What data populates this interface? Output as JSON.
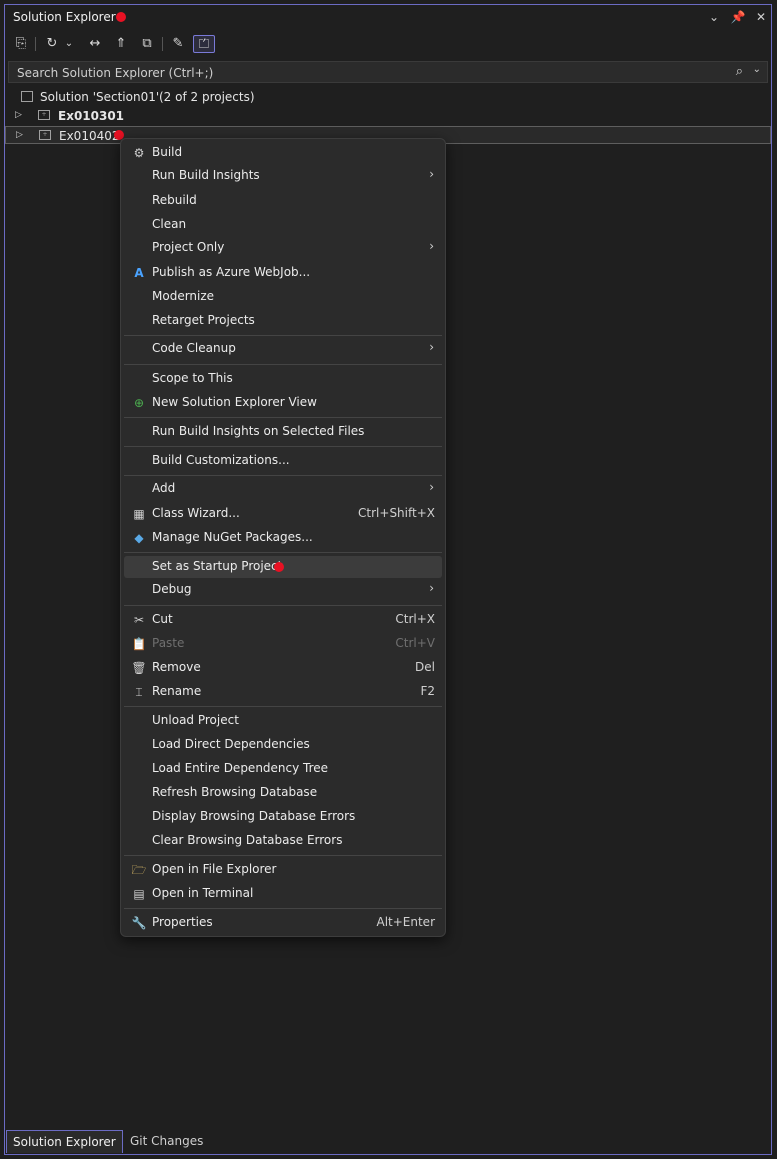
{
  "window": {
    "title": "Solution Explorer",
    "buttons": [
      "chevron-down-icon",
      "pin-icon",
      "close-icon"
    ]
  },
  "toolbar": {
    "buttons": [
      {
        "name": "switch-views-icon",
        "glyph": "⎘"
      },
      {
        "name": "history-icon",
        "glyph": "↻"
      },
      {
        "name": "history-dropdown-icon",
        "glyph": "⌄"
      },
      {
        "name": "sync-icon",
        "glyph": "↔"
      },
      {
        "name": "collapse-all-icon",
        "glyph": "⇑"
      },
      {
        "name": "show-all-files-icon",
        "glyph": "⧉"
      },
      {
        "name": "properties-wrench-icon",
        "glyph": "✎"
      },
      {
        "name": "preview-selected-icon",
        "glyph": "⏍"
      }
    ]
  },
  "search": {
    "placeholder": "Search Solution Explorer (Ctrl+;)"
  },
  "tree": {
    "solution": "Solution 'Section01'",
    "solution_count": "(2 of 2 projects)",
    "projects": [
      {
        "name": "Ex010301",
        "bold": true
      },
      {
        "name": "Ex010402",
        "bold": false,
        "selected": true
      }
    ]
  },
  "context_menu": {
    "items": {
      "build": {
        "label": "Build"
      },
      "run_build_insights": {
        "label": "Run Build Insights"
      },
      "rebuild": {
        "label": "Rebuild"
      },
      "clean": {
        "label": "Clean"
      },
      "project_only": {
        "label": "Project Only"
      },
      "publish_azure": {
        "label": "Publish as Azure WebJob..."
      },
      "modernize": {
        "label": "Modernize"
      },
      "retarget": {
        "label": "Retarget Projects"
      },
      "code_cleanup": {
        "label": "Code Cleanup"
      },
      "scope_to_this": {
        "label": "Scope to This"
      },
      "new_se_view": {
        "label": "New Solution Explorer View"
      },
      "run_bi_selected": {
        "label": "Run Build Insights on Selected Files"
      },
      "build_custom": {
        "label": "Build Customizations..."
      },
      "add": {
        "label": "Add"
      },
      "class_wizard": {
        "label": "Class Wizard...",
        "shortcut": "Ctrl+Shift+X"
      },
      "nuget": {
        "label": "Manage NuGet Packages..."
      },
      "startup": {
        "label": "Set as Startup Project"
      },
      "debug": {
        "label": "Debug"
      },
      "cut": {
        "label": "Cut",
        "shortcut": "Ctrl+X"
      },
      "paste": {
        "label": "Paste",
        "shortcut": "Ctrl+V"
      },
      "remove": {
        "label": "Remove",
        "shortcut": "Del"
      },
      "rename": {
        "label": "Rename",
        "shortcut": "F2"
      },
      "unload": {
        "label": "Unload Project"
      },
      "load_direct": {
        "label": "Load Direct Dependencies"
      },
      "load_tree": {
        "label": "Load Entire Dependency Tree"
      },
      "refresh_db": {
        "label": "Refresh Browsing Database"
      },
      "display_db_err": {
        "label": "Display Browsing Database Errors"
      },
      "clear_db_err": {
        "label": "Clear Browsing Database Errors"
      },
      "open_explorer": {
        "label": "Open in File Explorer"
      },
      "open_terminal": {
        "label": "Open in Terminal"
      },
      "properties": {
        "label": "Properties",
        "shortcut": "Alt+Enter"
      }
    }
  },
  "bottom_tabs": [
    {
      "label": "Solution Explorer",
      "active": true
    },
    {
      "label": "Git Changes",
      "active": false
    }
  ],
  "colors": {
    "background": "#1f1f1f",
    "accent_border": "#6b6bc4",
    "marker_red": "#e81123",
    "menu_bg": "#2b2b2b"
  }
}
